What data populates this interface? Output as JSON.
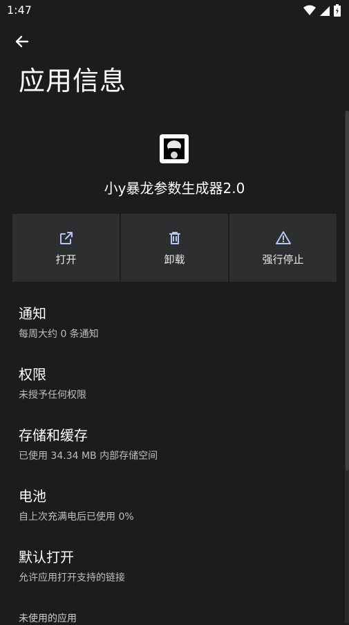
{
  "status": {
    "time": "1:47"
  },
  "header": {
    "title": "应用信息"
  },
  "app": {
    "name": "小y暴龙参数生成器2.0"
  },
  "actions": [
    {
      "label": "打开",
      "icon": "open-external-icon"
    },
    {
      "label": "卸载",
      "icon": "trash-icon"
    },
    {
      "label": "强行停止",
      "icon": "warning-icon"
    }
  ],
  "settings": [
    {
      "title": "通知",
      "subtitle": "每周大约 0 条通知"
    },
    {
      "title": "权限",
      "subtitle": "未授予任何权限"
    },
    {
      "title": "存储和缓存",
      "subtitle": "已使用 34.34 MB 内部存储空间"
    },
    {
      "title": "电池",
      "subtitle": "自上次充满电后已使用 0%"
    },
    {
      "title": "默认打开",
      "subtitle": "允许应用打开支持的链接"
    }
  ],
  "section_partial": "未使用的应用"
}
